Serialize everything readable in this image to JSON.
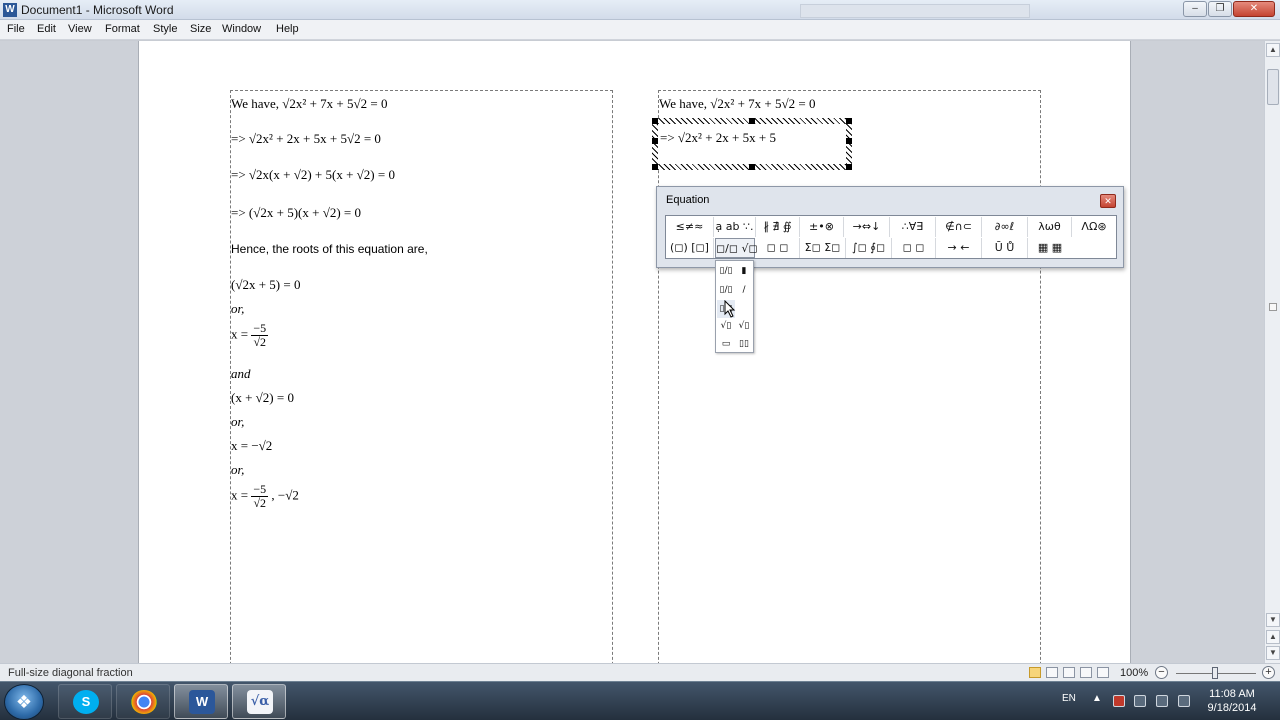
{
  "window": {
    "app_icon": "W",
    "title": "Document1 - Microsoft Word",
    "minimize_icon": "minimize-icon",
    "maximize_icon": "maximize-icon",
    "close_icon": "close-icon"
  },
  "menu": [
    "File",
    "Edit",
    "View",
    "Format",
    "Style",
    "Size",
    "Window",
    "Help"
  ],
  "left_column": {
    "line1": "We have,  √2x² + 7x + 5√2 = 0",
    "line2": "=> √2x² + 2x + 5x + 5√2 = 0",
    "line3": "=> √2x(x + √2) + 5(x + √2) = 0",
    "line4": "=> (√2x + 5)(x + √2) = 0",
    "line5": "Hence, the roots of this equation are,",
    "line6": "(√2x + 5) = 0",
    "or1": "or,",
    "line7_lhs": "x =",
    "line7_num": "−5",
    "line7_den": "√2",
    "and": "and",
    "line8": "(x + √2) = 0",
    "or2": "or,",
    "line9": "x = −√2",
    "or3": "or,",
    "line10_lhs": "x =",
    "line10_num": "−5",
    "line10_den": "√2",
    "line10_rest": ", −√2"
  },
  "right_column": {
    "line1": "We have,  √2x² + 7x + 5√2 = 0",
    "editing_line": "=> √2x² + 2x + 5x + 5"
  },
  "equation_toolbar": {
    "title": "Equation",
    "row1": [
      "≤≠≈",
      "ạ ab ∵.",
      "∦ ∄ ∯",
      "±•⊗",
      "→⇔↓",
      "∴∀∃",
      "∉∩⊂",
      "∂∞ℓ",
      "λωθ",
      "ΛΩ⊛"
    ],
    "row2": [
      "(◻) [◻]",
      "◻/◻ √◻",
      "◻ ◻",
      "Σ◻ Σ◻",
      "∫◻ ∮◻",
      "◻ ◻",
      "→ ←",
      "Ū Ů",
      "▦ ▦"
    ],
    "dropdown": [
      "▯/▯",
      "▮",
      "▯/▯",
      "/",
      "▯/▯",
      "√▯",
      "√▯",
      "▭",
      "▯▯"
    ]
  },
  "status": {
    "text": "Full-size diagonal fraction",
    "zoom": "100%",
    "zoom_out": "−",
    "zoom_in": "+"
  },
  "taskbar": {
    "start_icon": "windows-start-icon",
    "apps": [
      {
        "name": "skype",
        "glyph": "S",
        "color": "#00aff0"
      },
      {
        "name": "chrome",
        "glyph": "◉",
        "color": "#3e8e41"
      },
      {
        "name": "word",
        "glyph": "W",
        "color": "#2b579a"
      },
      {
        "name": "equation-editor",
        "glyph": "√α",
        "color": "#3a5fa8"
      }
    ],
    "lang": "EN",
    "time": "11:08 AM",
    "date": "9/18/2014"
  }
}
